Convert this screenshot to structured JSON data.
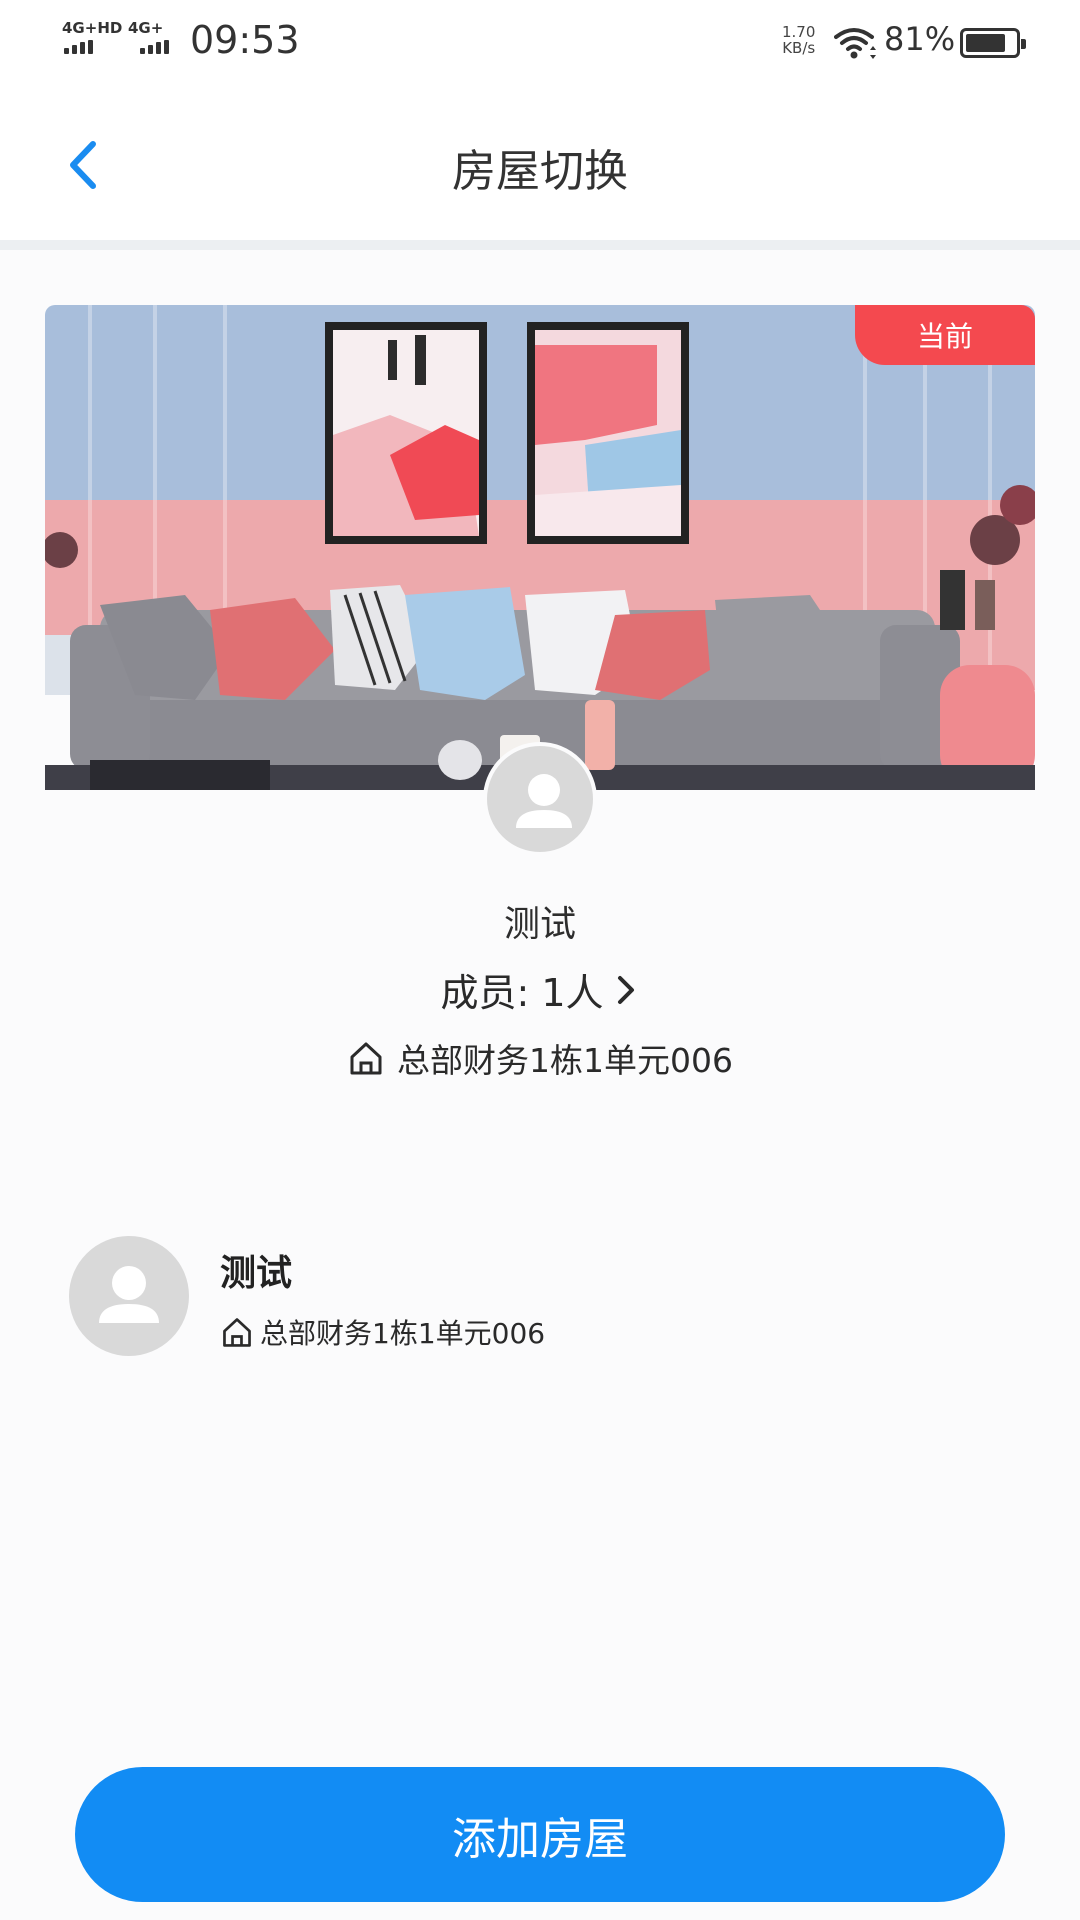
{
  "status_bar": {
    "network_1": "4G+HD",
    "network_2": "4G+",
    "time": "09:53",
    "speed_value": "1.70",
    "speed_unit": "KB/s",
    "battery_percent_text": "81%",
    "battery_level": 0.81
  },
  "header": {
    "title": "房屋切换",
    "back_icon": "chevron-left-icon",
    "accent_color": "#1a8cf0"
  },
  "current_house": {
    "badge": "当前",
    "badge_color": "#f4494f",
    "name": "测试",
    "members_label": "成员: 1人",
    "address": "总部财务1栋1单元006"
  },
  "houses": [
    {
      "name": "测试",
      "address": "总部财务1栋1单元006"
    }
  ],
  "actions": {
    "add_house_label": "添加房屋",
    "button_color": "#128cf4"
  }
}
